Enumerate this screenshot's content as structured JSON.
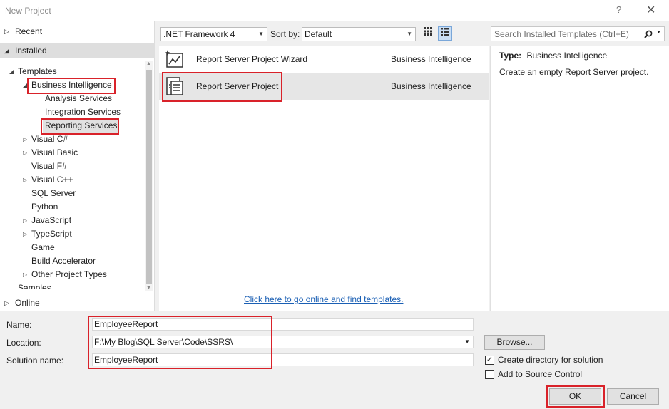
{
  "window": {
    "title": "New Project",
    "help_glyph": "?",
    "close_glyph": "✕"
  },
  "left": {
    "recent": "Recent",
    "installed": "Installed",
    "online": "Online",
    "tree": [
      {
        "label": "Templates"
      },
      {
        "label": "Business Intelligence"
      },
      {
        "label": "Analysis Services"
      },
      {
        "label": "Integration Services"
      },
      {
        "label": "Reporting Services"
      },
      {
        "label": "Visual C#"
      },
      {
        "label": "Visual Basic"
      },
      {
        "label": "Visual F#"
      },
      {
        "label": "Visual C++"
      },
      {
        "label": "SQL Server"
      },
      {
        "label": "Python"
      },
      {
        "label": "JavaScript"
      },
      {
        "label": "TypeScript"
      },
      {
        "label": "Game"
      },
      {
        "label": "Build Accelerator"
      },
      {
        "label": "Other Project Types"
      },
      {
        "label": "Samples"
      }
    ]
  },
  "toolbar": {
    "framework": ".NET Framework 4",
    "sort_label": "Sort by:",
    "sort_value": "Default",
    "search_placeholder": "Search Installed Templates (Ctrl+E)"
  },
  "templates": [
    {
      "name": "Report Server Project Wizard",
      "category": "Business Intelligence"
    },
    {
      "name": "Report Server Project",
      "category": "Business Intelligence"
    }
  ],
  "online_link": "Click here to go online and find templates.",
  "details": {
    "type_label": "Type:",
    "type_value": "Business Intelligence",
    "description": "Create an empty Report Server project."
  },
  "form": {
    "name_label": "Name:",
    "name_value": "EmployeeReport",
    "location_label": "Location:",
    "location_value": "F:\\My Blog\\SQL Server\\Code\\SSRS\\",
    "solution_label": "Solution name:",
    "solution_value": "EmployeeReport",
    "browse": "Browse...",
    "create_dir": "Create directory for solution",
    "create_dir_checked": true,
    "add_source": "Add to Source Control",
    "add_source_checked": false,
    "ok": "OK",
    "cancel": "Cancel"
  },
  "colors": {
    "highlight_box": "#d9222a",
    "link": "#1a5fb4",
    "selected_bg": "#e6e6e6"
  }
}
